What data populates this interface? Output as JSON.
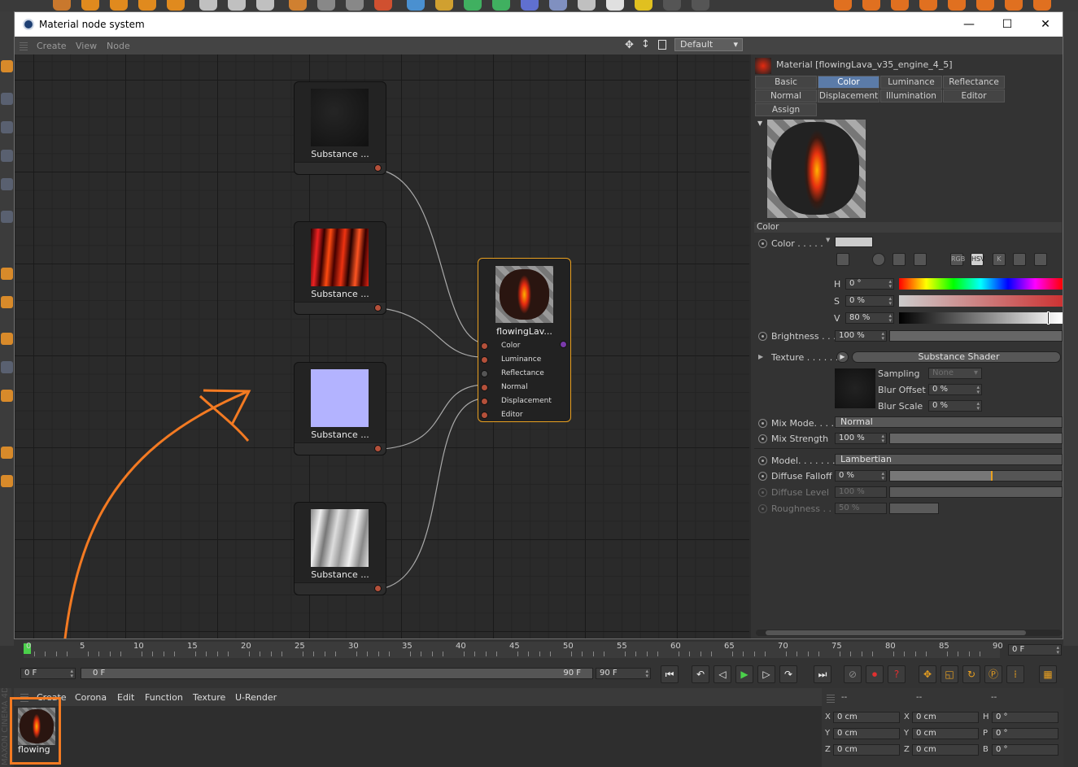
{
  "window": {
    "title": "Material node system",
    "layout": "Default",
    "controls": {
      "minimize": "—",
      "maximize": "☐",
      "close": "✕"
    }
  },
  "menu": [
    "Create",
    "View",
    "Node"
  ],
  "nodes": [
    {
      "label": "Substance ..."
    },
    {
      "label": "Substance ..."
    },
    {
      "label": "Substance ..."
    },
    {
      "label": "Substance ..."
    }
  ],
  "material_node": {
    "label": "flowingLav...",
    "inputs": [
      "Color",
      "Luminance",
      "Reflectance",
      "Normal",
      "Displacement",
      "Editor"
    ]
  },
  "attr": {
    "header": "Material [flowingLava_v35_engine_4_5]",
    "tabs": [
      "Basic",
      "Color",
      "Luminance",
      "Reflectance",
      "Normal",
      "Displacement",
      "Illumination",
      "Editor",
      "Assign"
    ],
    "active_tab": "Color",
    "section": "Color",
    "color_label": "Color . . . . .",
    "hsv": {
      "h_label": "H",
      "h": "0 °",
      "s_label": "S",
      "s": "0 %",
      "v_label": "V",
      "v": "80 %"
    },
    "color_buttons": [
      "RGB",
      "HSV",
      "K"
    ],
    "brightness_label": "Brightness . . .",
    "brightness": "100 %",
    "texture_label": "Texture . . . . . .",
    "texture": "Substance Shader",
    "sampling_label": "Sampling",
    "sampling": "None",
    "blur_offset_label": "Blur Offset",
    "blur_offset": "0 %",
    "blur_scale_label": "Blur Scale",
    "blur_scale": "0 %",
    "mix_mode_label": "Mix Mode. . . .",
    "mix_mode": "Normal",
    "mix_strength_label": "Mix Strength",
    "mix_strength": "100 %",
    "model_label": "Model. . . . . . .",
    "model": "Lambertian",
    "diffuse_falloff_label": "Diffuse Falloff",
    "diffuse_falloff": "0 %",
    "diffuse_level_label": "Diffuse Level",
    "diffuse_level": "100 %",
    "roughness_label": "Roughness . . .",
    "roughness": "50 %"
  },
  "timeline": {
    "ticks": [
      "0",
      "5",
      "10",
      "15",
      "20",
      "25",
      "30",
      "35",
      "40",
      "45",
      "50",
      "55",
      "60",
      "65",
      "70",
      "75",
      "80",
      "85",
      "90"
    ],
    "current": "0 F",
    "start": "0 F",
    "range_start": "0 F",
    "range_end": "90 F",
    "end": "90 F"
  },
  "material_manager": {
    "menu": [
      "Create",
      "Corona",
      "Edit",
      "Function",
      "Texture",
      "U-Render"
    ],
    "material_name": "flowing",
    "side_label": "MAXON CINEMA 4D"
  },
  "coords": {
    "headers": [
      "--",
      "--",
      "--"
    ],
    "rows": [
      {
        "a": "X",
        "av": "0 cm",
        "b": "X",
        "bv": "0 cm",
        "c": "H",
        "cv": "0 °"
      },
      {
        "a": "Y",
        "av": "0 cm",
        "b": "Y",
        "bv": "0 cm",
        "c": "P",
        "cv": "0 °"
      },
      {
        "a": "Z",
        "av": "0 cm",
        "b": "Z",
        "bv": "0 cm",
        "c": "B",
        "cv": "0 °"
      }
    ]
  },
  "colors": {
    "accent": "#5b7ba8",
    "annotation": "#f37a22",
    "node_port": "#b4503a",
    "selected_node": "#e9a020"
  }
}
